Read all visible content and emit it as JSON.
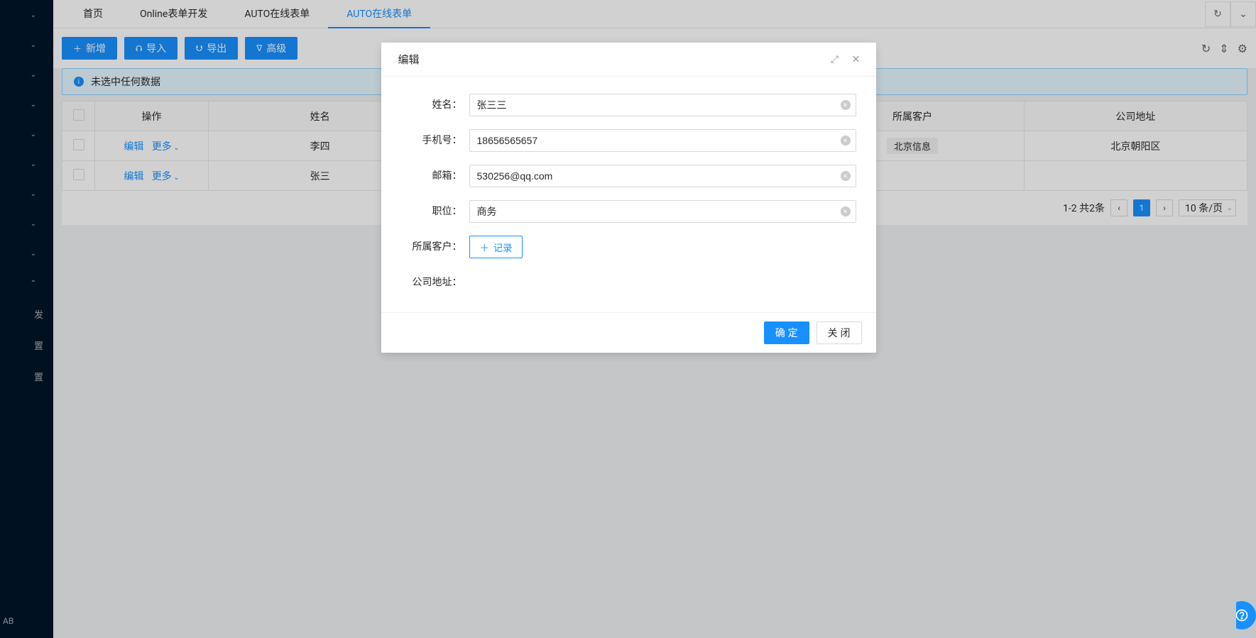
{
  "sidebar": {
    "collapsed_items_count": 9,
    "open_item_index": 9,
    "sub_items": [
      "发",
      "置",
      "置"
    ],
    "footer": "AB"
  },
  "tabs": {
    "items": [
      {
        "label": "首页"
      },
      {
        "label": "Online表单开发"
      },
      {
        "label": "AUTO在线表单"
      },
      {
        "label": "AUTO在线表单"
      }
    ],
    "active_index": 3
  },
  "toolbar": {
    "new": "新增",
    "import": "导入",
    "export": "导出",
    "advanced": "高级"
  },
  "alert": {
    "text": "未选中任何数据"
  },
  "table": {
    "columns": [
      "操作",
      "姓名",
      "所属客户",
      "公司地址"
    ],
    "op_edit": "编辑",
    "op_more": "更多",
    "rows": [
      {
        "name": "李四",
        "customer_tag": "北京信息",
        "addr": "北京朝阳区"
      },
      {
        "name": "张三",
        "customer_tag": "",
        "addr": ""
      }
    ]
  },
  "pagination": {
    "summary": "1-2 共2条",
    "page": "1",
    "size_label": "10 条/页"
  },
  "modal": {
    "title": "编辑",
    "fields": {
      "name_label": "姓名：",
      "name": "张三三",
      "phone_label": "手机号：",
      "phone": "18656565657",
      "email_label": "邮箱：",
      "email": "530256@qq.com",
      "position_label": "职位：",
      "position": "商务",
      "customer_label": "所属客户：",
      "customer_btn": "记录",
      "addr_label": "公司地址："
    },
    "ok": "确 定",
    "cancel": "关 闭"
  }
}
